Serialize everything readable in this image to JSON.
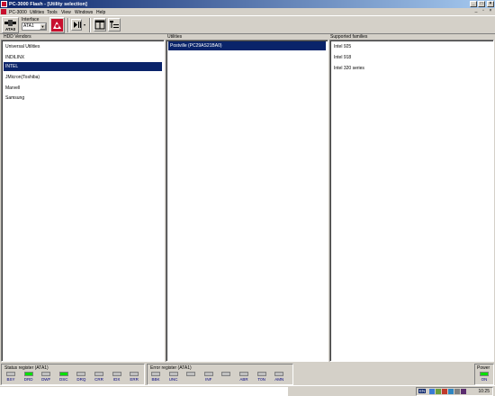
{
  "window": {
    "title": "PC-3000 Flash - [Utility selection]",
    "colors": {
      "titlebar": "#0a246a",
      "selection": "#0a246a",
      "led_on": "#00e000",
      "app_red": "#c8102e"
    }
  },
  "menu": {
    "items": [
      "PC-3000",
      "Utilities",
      "Tools",
      "View",
      "Windows",
      "Help"
    ]
  },
  "toolbar": {
    "ata_label": "ATA0",
    "interface_label": "Interface",
    "interface_value": "ATA1"
  },
  "panes": {
    "vendors": {
      "label": "HDD Vendors",
      "items": [
        "Universal Utilities",
        "INDILINX",
        "INTEL",
        "JMicron(Toshiba)",
        "Marvell",
        "Samsung"
      ],
      "selected": "INTEL"
    },
    "utilities": {
      "label": "Utilities",
      "items": [
        "Postville (PC29AS21BA0)"
      ],
      "selected": "Postville (PC29AS21BA0)"
    },
    "families": {
      "label": "Supported families",
      "items": [
        "Intel 925",
        "Intel 918",
        "Intel 320 series"
      ]
    }
  },
  "status": {
    "status_register": {
      "title": "Status register (ATA1)",
      "leds": [
        {
          "label": "BSY",
          "on": false
        },
        {
          "label": "DRD",
          "on": true
        },
        {
          "label": "DWF",
          "on": false
        },
        {
          "label": "DSC",
          "on": true
        },
        {
          "label": "DRQ",
          "on": false
        },
        {
          "label": "CRR",
          "on": false
        },
        {
          "label": "IDX",
          "on": false
        },
        {
          "label": "ERR",
          "on": false
        }
      ]
    },
    "error_register": {
      "title": "Error register (ATA1)",
      "leds": [
        {
          "label": "BBK",
          "on": false
        },
        {
          "label": "UNC",
          "on": false
        },
        {
          "label": "",
          "on": false
        },
        {
          "label": "INF",
          "on": false
        },
        {
          "label": "",
          "on": false
        },
        {
          "label": "ABR",
          "on": false
        },
        {
          "label": "T0N",
          "on": false
        },
        {
          "label": "AMN",
          "on": false
        }
      ]
    },
    "power": {
      "title": "Power",
      "label": "ON",
      "on": true
    }
  },
  "taskbar": {
    "lang": "EN",
    "clock": "10:25"
  }
}
